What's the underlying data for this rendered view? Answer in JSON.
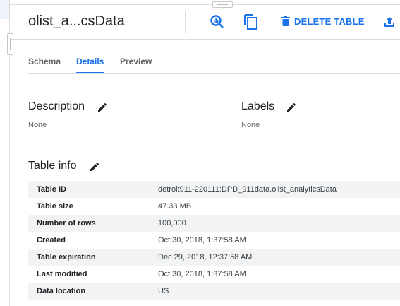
{
  "header": {
    "title": "olist_a...csData",
    "delete_label": "DELETE TABLE"
  },
  "tabs": [
    {
      "label": "Schema"
    },
    {
      "label": "Details"
    },
    {
      "label": "Preview"
    }
  ],
  "description": {
    "heading": "Description",
    "value": "None"
  },
  "labels": {
    "heading": "Labels",
    "value": "None"
  },
  "table_info": {
    "heading": "Table info",
    "rows": [
      {
        "key": "Table ID",
        "value": "detroit911-220111:DPD_911data.olist_analyticsData"
      },
      {
        "key": "Table size",
        "value": "47.33 MB"
      },
      {
        "key": "Number of rows",
        "value": "100,000"
      },
      {
        "key": "Created",
        "value": "Oct 30, 2018, 1:37:58 AM"
      },
      {
        "key": "Table expiration",
        "value": "Dec 29, 2018, 12:37:58 AM"
      },
      {
        "key": "Last modified",
        "value": "Oct 30, 2018, 1:37:58 AM"
      },
      {
        "key": "Data location",
        "value": "US"
      }
    ]
  },
  "colors": {
    "accent": "#1a73e8",
    "row_alt": "#f1f3f4"
  }
}
